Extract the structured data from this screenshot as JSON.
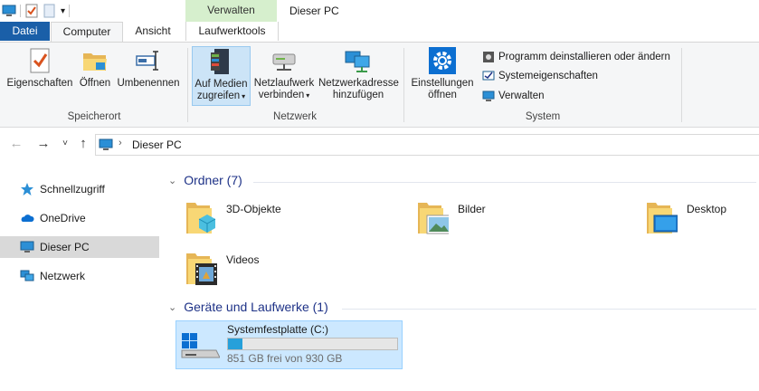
{
  "window": {
    "title": "Dieser PC",
    "context_group": "Verwalten"
  },
  "tabs": {
    "datei": "Datei",
    "computer": "Computer",
    "ansicht": "Ansicht",
    "laufwerkstools": "Laufwerktools"
  },
  "ribbon": {
    "speicherort": {
      "label": "Speicherort",
      "eigenschaften": "Eigenschaften",
      "oeffnen": "Öffnen",
      "umbenennen": "Umbenennen"
    },
    "netzwerk": {
      "label": "Netzwerk",
      "medien_1": "Auf Medien",
      "medien_2": "zugreifen",
      "netzlaufwerk_1": "Netzlaufwerk",
      "netzlaufwerk_2": "verbinden",
      "netzadresse_1": "Netzwerkadresse",
      "netzadresse_2": "hinzufügen"
    },
    "system": {
      "label": "System",
      "einstellungen_1": "Einstellungen",
      "einstellungen_2": "öffnen",
      "programm": "Programm deinstallieren oder ändern",
      "systemeigenschaften": "Systemeigenschaften",
      "verwalten": "Verwalten"
    }
  },
  "address": {
    "path": "Dieser PC"
  },
  "sidebar": {
    "items": [
      {
        "label": "Schnellzugriff",
        "icon": "star-icon"
      },
      {
        "label": "OneDrive",
        "icon": "cloud-icon"
      },
      {
        "label": "Dieser PC",
        "icon": "computer-icon"
      },
      {
        "label": "Netzwerk",
        "icon": "network-icon"
      }
    ]
  },
  "content": {
    "ordner_header": "Ordner (7)",
    "folders": [
      "3D-Objekte",
      "Bilder",
      "Desktop",
      "Videos"
    ],
    "geraete_header": "Geräte und Laufwerke (1)",
    "drive": {
      "name": "Systemfestplatte (C:)",
      "free": "851 GB frei von 930 GB",
      "used_fraction": 0.085
    }
  },
  "colors": {
    "accent": "#1a5fa8",
    "context_tab": "#d6efcd",
    "selection": "#cce8ff",
    "drive_bar": "#26a0da"
  }
}
